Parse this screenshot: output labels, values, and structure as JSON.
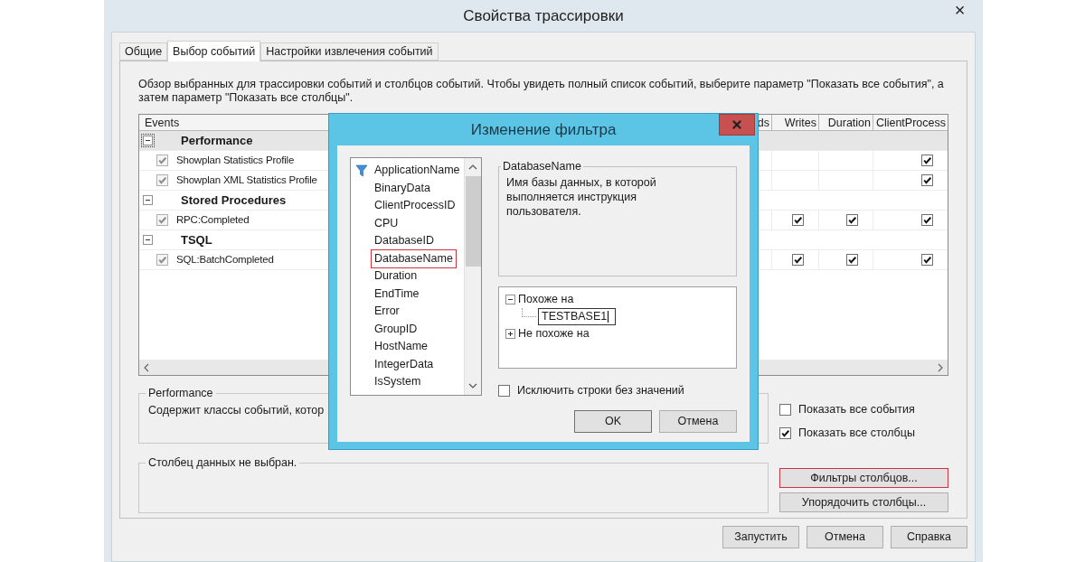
{
  "window": {
    "title": "Свойства трассировки",
    "close": "×"
  },
  "tabs": [
    {
      "label": "Общие",
      "selected": false
    },
    {
      "label": "Выбор событий",
      "selected": true
    },
    {
      "label": "Настройки извлечения событий",
      "selected": false
    }
  ],
  "description": "Обзор выбранных для трассировки событий и столбцов событий. Чтобы увидеть полный список событий, выберите параметр \"Показать все события\", а затем параметр \"Показать все столбцы\".",
  "table": {
    "events_column": "Events",
    "columns": [
      "ds",
      "Writes",
      "Duration",
      "ClientProcess"
    ],
    "groups": [
      {
        "name": "Performance",
        "expanded": true,
        "selected": true,
        "children": [
          {
            "name": "Showplan Statistics Profile",
            "checked": true,
            "checks": [
              false,
              false,
              true
            ]
          },
          {
            "name": "Showplan XML Statistics Profile",
            "checked": true,
            "checks": [
              false,
              false,
              true
            ]
          }
        ]
      },
      {
        "name": "Stored Procedures",
        "expanded": true,
        "selected": false,
        "children": [
          {
            "name": "RPC:Completed",
            "checked": true,
            "checks": [
              true,
              true,
              true
            ]
          }
        ]
      },
      {
        "name": "TSQL",
        "expanded": true,
        "selected": false,
        "children": [
          {
            "name": "SQL:BatchCompleted",
            "checked": true,
            "checks": [
              true,
              true,
              true
            ]
          }
        ]
      }
    ]
  },
  "event_info": {
    "title": "Performance",
    "text": "Содержит классы событий, котор"
  },
  "column_info": {
    "title": "Столбец данных не выбран."
  },
  "options": [
    {
      "label": "Показать все события",
      "checked": false
    },
    {
      "label": "Показать все столбцы",
      "checked": true
    }
  ],
  "side_buttons": [
    {
      "label": "Фильтры столбцов...",
      "focused": true
    },
    {
      "label": "Упорядочить столбцы...",
      "focused": false
    }
  ],
  "buttons": [
    "Запустить",
    "Отмена",
    "Справка"
  ],
  "dialog": {
    "title": "Изменение фильтра",
    "fields": [
      {
        "label": "ApplicationName",
        "filtered": true,
        "selected": false
      },
      {
        "label": "BinaryData",
        "filtered": false,
        "selected": false
      },
      {
        "label": "ClientProcessID",
        "filtered": false,
        "selected": false
      },
      {
        "label": "CPU",
        "filtered": false,
        "selected": false
      },
      {
        "label": "DatabaseID",
        "filtered": false,
        "selected": false
      },
      {
        "label": "DatabaseName",
        "filtered": false,
        "selected": true
      },
      {
        "label": "Duration",
        "filtered": false,
        "selected": false
      },
      {
        "label": "EndTime",
        "filtered": false,
        "selected": false
      },
      {
        "label": "Error",
        "filtered": false,
        "selected": false
      },
      {
        "label": "GroupID",
        "filtered": false,
        "selected": false
      },
      {
        "label": "HostName",
        "filtered": false,
        "selected": false
      },
      {
        "label": "IntegerData",
        "filtered": false,
        "selected": false
      },
      {
        "label": "IsSystem",
        "filtered": false,
        "selected": false
      }
    ],
    "info_title": "DatabaseName",
    "info_text": "Имя базы данных, в которой выполняется инструкция пользователя.",
    "conditions": [
      {
        "label": "Похоже на",
        "expanded": true,
        "values": [
          "TESTBASE1"
        ]
      },
      {
        "label": "Не похоже на",
        "expanded": false
      }
    ],
    "exclude_empty": {
      "label": "Исключить строки без значений",
      "checked": false
    },
    "buttons": [
      "OK",
      "Отмена"
    ]
  }
}
